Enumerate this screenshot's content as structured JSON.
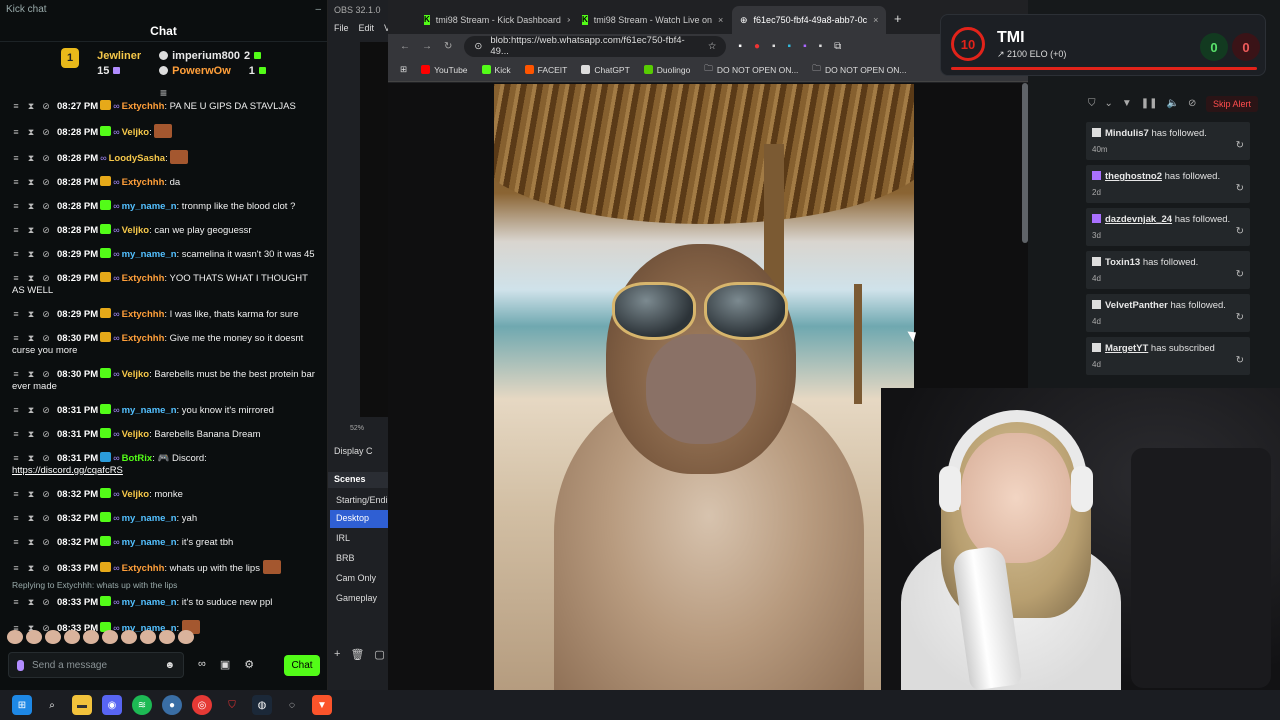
{
  "kick_chat": {
    "window_title": "Kick chat",
    "header": "Chat",
    "leaderboard": {
      "rank_badge": "1",
      "left": [
        {
          "name": "Jewliner",
          "value": "15"
        }
      ],
      "right": [
        {
          "name": "imperium800",
          "value": "2"
        },
        {
          "name": "PowerwOw",
          "value": "1"
        }
      ]
    },
    "messages": [
      {
        "time": "08:27 PM",
        "user": "Extychhh",
        "user_color": "#ff9f3a",
        "badge": "crown",
        "text": ": PA NE U GIPS DA STAVLJAS"
      },
      {
        "time": "08:28 PM",
        "user": "Veljko",
        "user_color": "#f6c84a",
        "badge": "k",
        "text": ":",
        "emote": true
      },
      {
        "time": "08:28 PM",
        "user": "LoodySasha",
        "user_color": "#f6c84a",
        "badge": "",
        "text": ":",
        "emote": true
      },
      {
        "time": "08:28 PM",
        "user": "Extychhh",
        "user_color": "#ff9f3a",
        "badge": "crown",
        "text": ": da"
      },
      {
        "time": "08:28 PM",
        "user": "my_name_n",
        "user_color": "#53c0ff",
        "badge": "k",
        "text": ": tronmp like the blood clot ?"
      },
      {
        "time": "08:28 PM",
        "user": "Veljko",
        "user_color": "#f6c84a",
        "badge": "k",
        "text": ": can we play geoguessr"
      },
      {
        "time": "08:29 PM",
        "user": "my_name_n",
        "user_color": "#53c0ff",
        "badge": "k",
        "text": ": scamelina it wasn't 30 it was 45"
      },
      {
        "time": "08:29 PM",
        "user": "Extychhh",
        "user_color": "#ff9f3a",
        "badge": "crown",
        "text": ": YOO THATS WHAT I THOUGHT AS WELL"
      },
      {
        "time": "08:29 PM",
        "user": "Extychhh",
        "user_color": "#ff9f3a",
        "badge": "crown",
        "text": ": I was like, thats karma for sure"
      },
      {
        "time": "08:30 PM",
        "user": "Extychhh",
        "user_color": "#ff9f3a",
        "badge": "crown",
        "text": ": Give me the money so it doesnt curse you more"
      },
      {
        "time": "08:30 PM",
        "user": "Veljko",
        "user_color": "#f6c84a",
        "badge": "k",
        "text": ": Barebells must be the best protein bar ever made"
      },
      {
        "time": "08:31 PM",
        "user": "my_name_n",
        "user_color": "#53c0ff",
        "badge": "k",
        "text": ": you know it's mirrored"
      },
      {
        "time": "08:31 PM",
        "user": "Veljko",
        "user_color": "#f6c84a",
        "badge": "k",
        "text": ": Barebells Banana Dream"
      },
      {
        "time": "08:31 PM",
        "user": "BotRix",
        "user_color": "#53fc18",
        "badge": "mod",
        "text": ": 🎮 Discord:",
        "link": "https://discord.gg/cqafcRS"
      },
      {
        "time": "08:32 PM",
        "user": "Veljko",
        "user_color": "#f6c84a",
        "badge": "k",
        "text": ": monke"
      },
      {
        "time": "08:32 PM",
        "user": "my_name_n",
        "user_color": "#53c0ff",
        "badge": "k",
        "text": ": yah"
      },
      {
        "time": "08:32 PM",
        "user": "my_name_n",
        "user_color": "#53c0ff",
        "badge": "k",
        "text": ": it's great tbh"
      },
      {
        "time": "08:33 PM",
        "user": "Extychhh",
        "user_color": "#ff9f3a",
        "badge": "crown",
        "text": ": whats up with the lips",
        "emote": true
      },
      {
        "time": "08:33 PM",
        "user": "my_name_n",
        "user_color": "#53c0ff",
        "badge": "k",
        "text": ": it's to suduce new ppl",
        "reply": "Replying to Extychhh: whats up with the lips"
      },
      {
        "time": "08:33 PM",
        "user": "my_name_n",
        "user_color": "#53c0ff",
        "badge": "k",
        "text": ":",
        "emote": true
      }
    ],
    "input_placeholder": "Send a message",
    "send_label": "Chat"
  },
  "obs": {
    "title": "OBS 32.1.0",
    "menu": [
      "File",
      "Edit",
      "V"
    ],
    "zoom": "52%",
    "display_label": "Display C",
    "scenes_header": "Scenes",
    "scenes": [
      "Starting/Endi",
      "Desktop",
      "IRL",
      "BRB",
      "Cam Only",
      "Gameplay"
    ],
    "selected_scene": "Desktop"
  },
  "browser": {
    "tabs": [
      {
        "title": "tmi98 Stream - Kick Dashboard",
        "icon": "kick-icon",
        "active": false
      },
      {
        "title": "tmi98 Stream - Watch Live on",
        "icon": "kick-icon",
        "active": false
      },
      {
        "title": "f61ec750-fbf4-49a8-abb7-0c",
        "icon": "globe-icon",
        "active": true
      }
    ],
    "url": "blob:https://web.whatsapp.com/f61ec750-fbf4-49...",
    "bookmarks": [
      {
        "label": "YouTube",
        "color": "#ff0000"
      },
      {
        "label": "Kick",
        "color": "#53fc18"
      },
      {
        "label": "FACEIT",
        "color": "#ff5500"
      },
      {
        "label": "ChatGPT",
        "color": "#dddddd"
      },
      {
        "label": "Duolingo",
        "color": "#58cc02"
      },
      {
        "label": "DO NOT OPEN ON...",
        "color": "#888888"
      },
      {
        "label": "DO NOT OPEN ON...",
        "color": "#888888"
      }
    ]
  },
  "faceit": {
    "level": "10",
    "name": "TMI",
    "elo": "↗ 2100 ELO (+0)",
    "wins": "0",
    "losses": "0"
  },
  "activity": {
    "skip_label": "Skip Alert",
    "events": [
      {
        "user": "Mindulis7",
        "action": " has followed.",
        "age": "40m",
        "platform": "kick",
        "underline": false
      },
      {
        "user": "theghostno2",
        "action": " has followed.",
        "age": "2d",
        "platform": "twitch",
        "underline": true
      },
      {
        "user": "dazdevnjak_24",
        "action": " has followed.",
        "age": "3d",
        "platform": "twitch",
        "underline": true
      },
      {
        "user": "Toxin13",
        "action": " has followed.",
        "age": "4d",
        "platform": "kick",
        "underline": false
      },
      {
        "user": "VelvetPanther",
        "action": " has followed.",
        "age": "4d",
        "platform": "kick",
        "underline": false
      },
      {
        "user": "MargetYT",
        "action": " has subscribed",
        "age": "4d",
        "platform": "kick",
        "underline": true
      }
    ]
  }
}
